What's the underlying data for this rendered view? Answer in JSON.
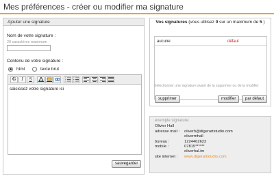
{
  "page": {
    "title": "Mes préférences - créer ou modifier ma signature"
  },
  "left_panel": {
    "header": "Ajouter une signature",
    "name_label": "Nom de votre signature :",
    "name_hint": "20 caractères maximum",
    "name_value": "",
    "content_label": "Contenu de votre signature :",
    "radio_html": "html",
    "radio_text": "texte brut",
    "selected_format": "html",
    "toolbar": [
      "bold-icon",
      "italic-icon",
      "underline-icon",
      "text-color-icon",
      "bg-color-icon",
      "link-icon",
      "unordered-list-icon",
      "ordered-list-icon",
      "align-left-icon",
      "align-center-icon",
      "align-right-icon",
      "align-justify-icon"
    ],
    "editor_text": "saisissez votre signature ici",
    "save_button": "sauvegarder"
  },
  "right_top": {
    "header_bold1": "Vos signatures",
    "header_part1": " (vous utilisez ",
    "header_used": "0",
    "header_part2": " sur un maximum de ",
    "header_max": "5",
    "header_part3": " )",
    "signatures": [
      {
        "name": "aucune",
        "status": "défaut"
      }
    ],
    "hint": "Sélectionner une signature avant de la supprimer ou de la modifier",
    "delete_button": "supprimer",
    "modify_button": "modifier",
    "default_button": "par défaut"
  },
  "example": {
    "label": "exemple signature:",
    "name": "Olivier Hall",
    "rows": [
      {
        "key": "adresse mail :",
        "value": "oliverh@digerartstudio.com"
      },
      {
        "key": "",
        "value": "olivermhall"
      },
      {
        "key": "bureau :",
        "value": "1224462622"
      },
      {
        "key": "mobile :",
        "value": "07815******"
      },
      {
        "key": "",
        "value": "oliverhal.im"
      }
    ],
    "site_key": "site internet :",
    "site_value": "www.digerartstudio.com"
  },
  "colors": {
    "accent": "#e6a23c",
    "default_red": "#d21a1a",
    "site_orange": "#e8891c"
  }
}
